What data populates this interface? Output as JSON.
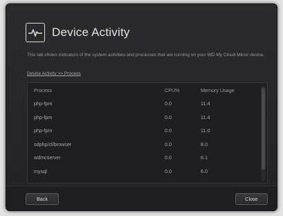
{
  "dialog": {
    "title": "Device Activity",
    "icon": "activity-pulse-icon",
    "description": "This tab shows indicators of the system activities and processes that are running on your WD My Cloud Mirror device.",
    "breadcrumb": "Device Activity >> Process"
  },
  "table": {
    "columns": [
      "Process",
      "CPU%",
      "Memory Usage"
    ],
    "rows": [
      [
        "php-fpm",
        "0.0",
        "11.4"
      ],
      [
        "php-fpm",
        "0.0",
        "11.4"
      ],
      [
        "php-fpm",
        "0.0",
        "11.0"
      ],
      [
        "sdphp/cl/browser",
        "0.0",
        "8.0"
      ],
      [
        "wdmcserver",
        "0.0",
        "6.1"
      ],
      [
        "mysql",
        "0.0",
        "6.0"
      ]
    ]
  },
  "footer": {
    "back_label": "Back",
    "close_label": "Close"
  }
}
